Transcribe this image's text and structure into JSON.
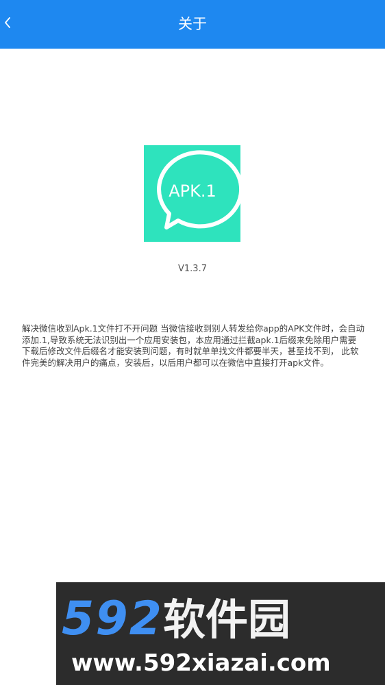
{
  "header": {
    "title": "关于",
    "back_icon": "chevron-left-icon"
  },
  "app": {
    "icon_text": "APK.1",
    "icon_color": "#2ee3bd",
    "version": "V1.3.7"
  },
  "description": "解决微信收到Apk.1文件打不开问题 当微信接收到别人转发给你app的APK文件时，会自动添加.1,导致系统无法识别出一个应用安装包，本应用通过拦截apk.1后缀来免除用户需要下载后修改文件后缀名才能安装到问题，有时就单单找文件都要半天，甚至找不到，  此软件完美的解决用户的痛点，安装后，以后用户都可以在微信中直接打开apk文件。",
  "watermark": {
    "number": "592",
    "name": "软件园",
    "url": "www.592xiazai.com"
  },
  "colors": {
    "app_bar": "#1e88f0",
    "accent": "#2ee3bd"
  }
}
